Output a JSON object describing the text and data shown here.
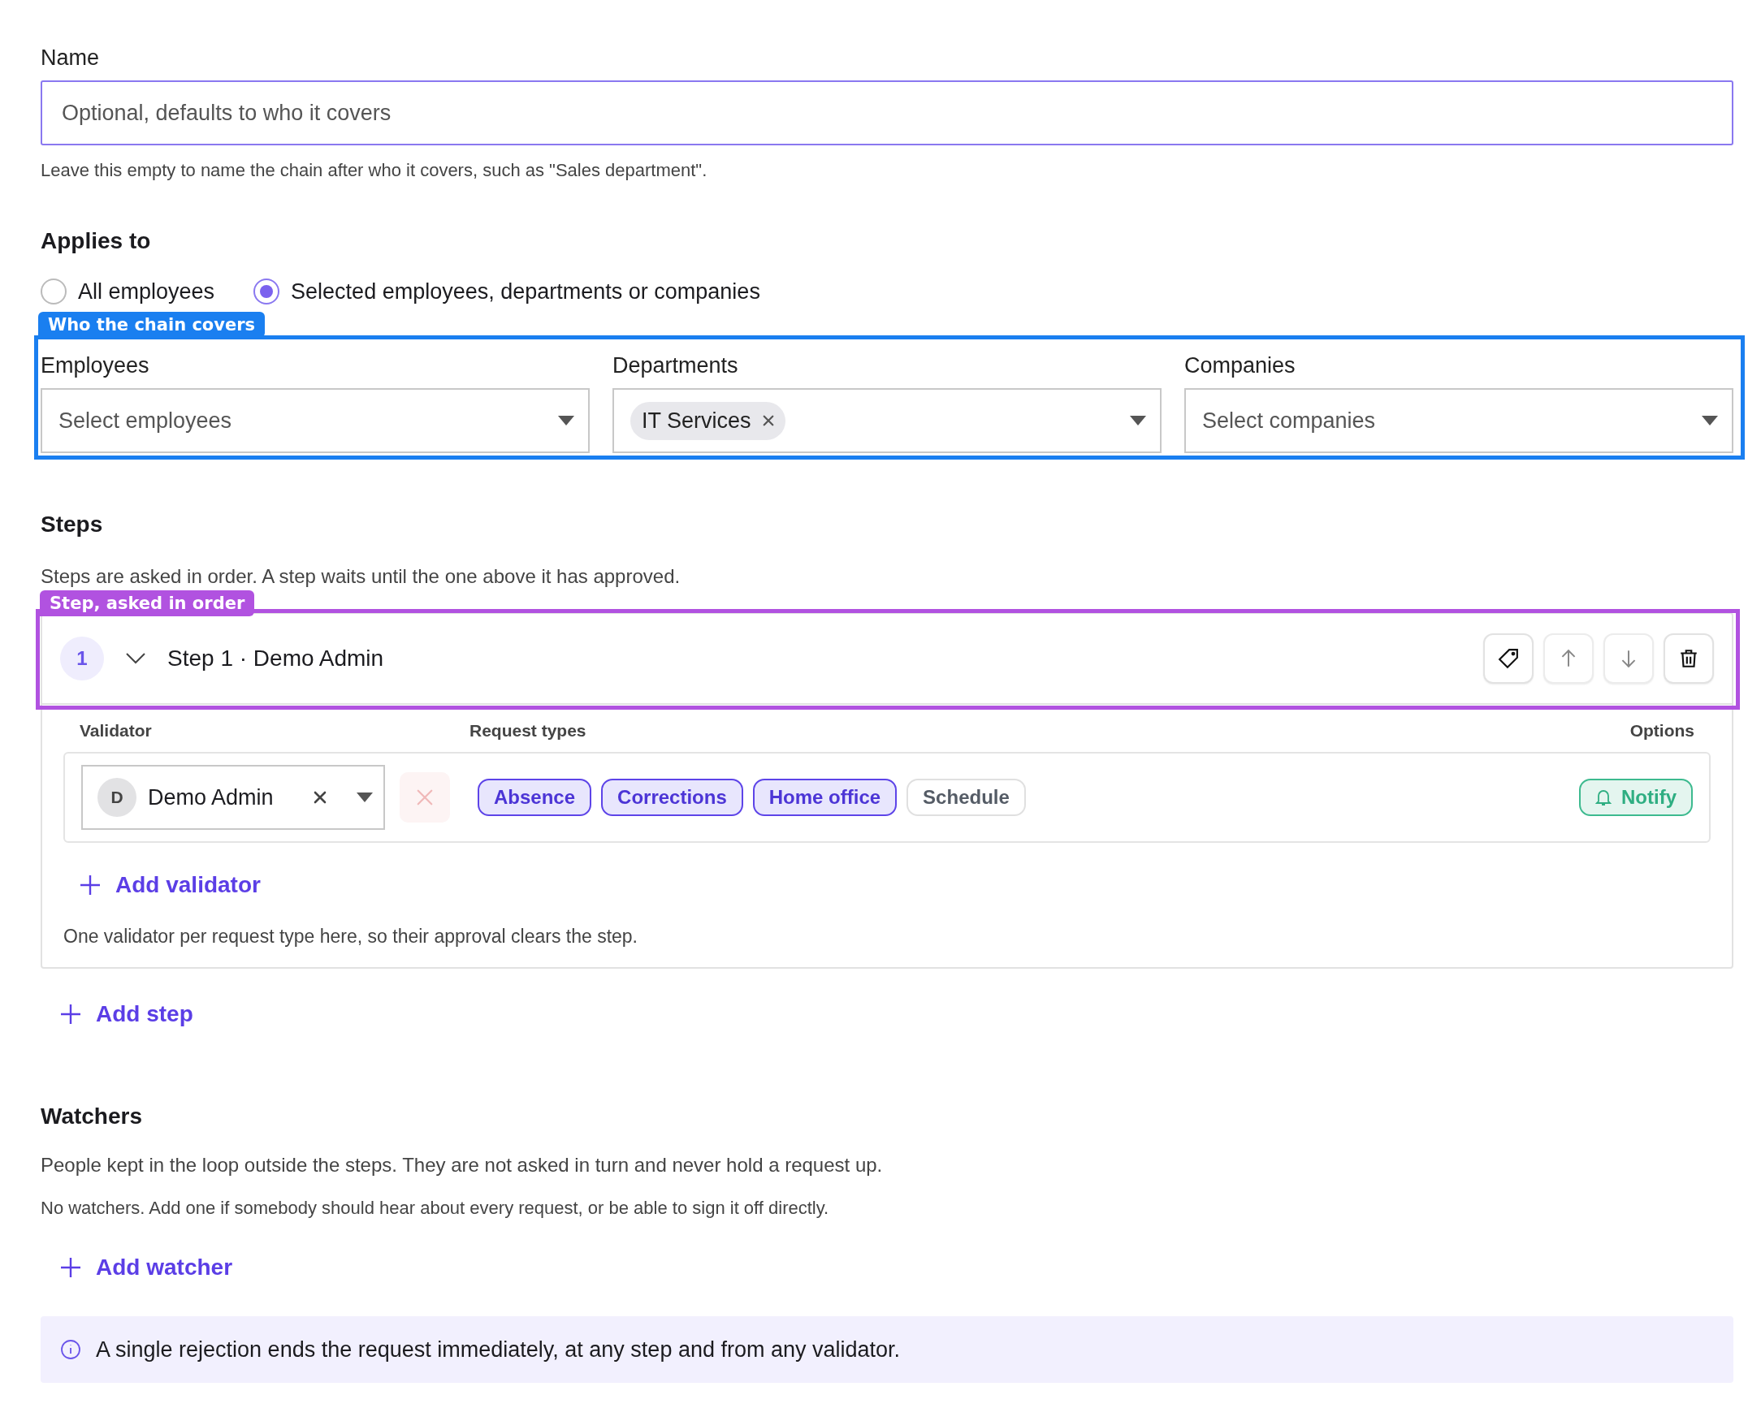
{
  "name_field": {
    "label": "Name",
    "placeholder": "Optional, defaults to who it covers",
    "help": "Leave this empty to name the chain after who it covers, such as \"Sales department\"."
  },
  "applies_to": {
    "heading": "Applies to",
    "options": [
      {
        "label": "All employees",
        "selected": false
      },
      {
        "label": "Selected employees, departments or companies",
        "selected": true
      }
    ],
    "annotation": {
      "label": "Who the chain covers",
      "color": "#1a7ff0"
    },
    "fields": [
      {
        "label": "Employees",
        "placeholder": "Select employees"
      },
      {
        "label": "Departments",
        "chips": [
          "IT Services"
        ]
      },
      {
        "label": "Companies",
        "placeholder": "Select companies"
      }
    ]
  },
  "steps": {
    "heading": "Steps",
    "intro": "Steps are asked in order. A step waits until the one above it has approved.",
    "items": [
      {
        "number": "1",
        "title": "Step 1 · Demo Admin",
        "expanded": true,
        "annotation": {
          "label": "Step, asked in order",
          "color": "#b152e0"
        },
        "actions": [
          {
            "kind": "tag",
            "disabled": false
          },
          {
            "kind": "up",
            "disabled": true
          },
          {
            "kind": "down",
            "disabled": true
          },
          {
            "kind": "delete",
            "disabled": false
          }
        ],
        "columns": [
          "Validator",
          "Request types",
          "Options"
        ],
        "validators": [
          {
            "initial": "D",
            "name": "Demo Admin",
            "remove_disabled": true,
            "request_types": [
              {
                "label": "Absence",
                "selected": true
              },
              {
                "label": "Corrections",
                "selected": true
              },
              {
                "label": "Home office",
                "selected": true
              },
              {
                "label": "Schedule",
                "selected": false
              }
            ],
            "notify": {
              "label": "Notify",
              "on": true
            }
          }
        ],
        "add_validator": "Add validator",
        "note": "One validator per request type here, so their approval clears the step."
      }
    ],
    "add_step": "Add step"
  },
  "watchers": {
    "heading": "Watchers",
    "intro": "People kept in the loop outside the steps. They are not asked in turn and never hold a request up.",
    "empty": "No watchers. Add one if somebody should hear about every request, or be able to sign it off directly.",
    "add": "Add watcher"
  },
  "info": "A single rejection ends the request immediately, at any step and from any validator."
}
